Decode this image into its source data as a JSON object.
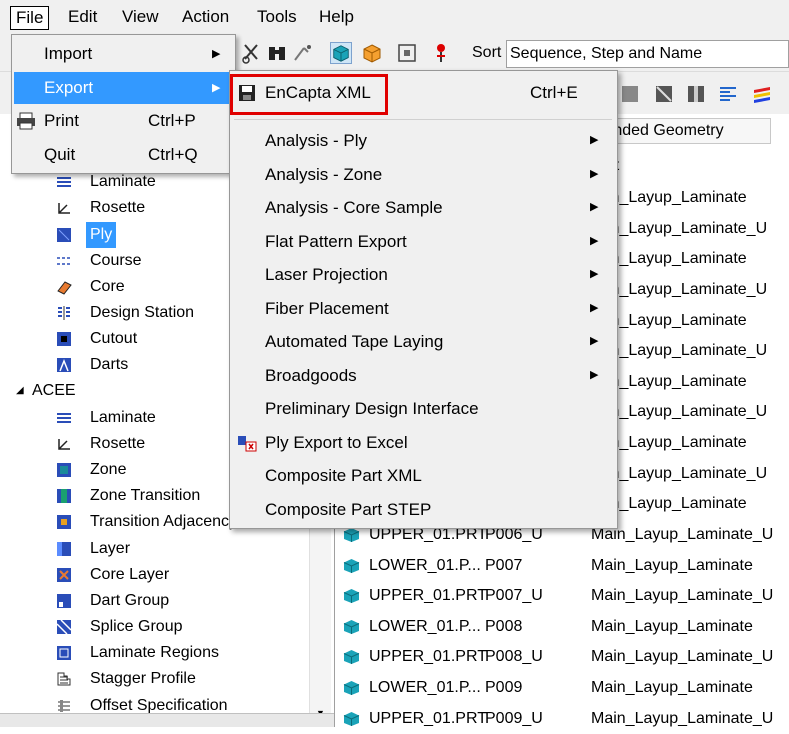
{
  "menubar": [
    "File",
    "Edit",
    "View",
    "Action",
    "Tools",
    "Help"
  ],
  "sort": {
    "label": "Sort",
    "value": "Sequence, Step and Name"
  },
  "columns": {
    "extended_geometry": "tended Geometry",
    "parent": "ent"
  },
  "file_menu": {
    "import": "Import",
    "export": "Export",
    "print": "Print",
    "print_shortcut": "Ctrl+P",
    "quit": "Quit",
    "quit_shortcut": "Ctrl+Q"
  },
  "export_menu": {
    "encapta": "EnCapta XML",
    "encapta_shortcut": "Ctrl+E",
    "items": [
      "Analysis - Ply",
      "Analysis - Zone",
      "Analysis - Core Sample",
      "Flat Pattern Export",
      "Laser Projection",
      "Fiber Placement",
      "Automated Tape Laying",
      "Broadgoods",
      "Preliminary Design Interface",
      "Ply Export to Excel",
      "Composite Part XML",
      "Composite Part STEP"
    ]
  },
  "tree": {
    "group1": [
      "Laminate",
      "Rosette",
      "Ply",
      "Course",
      "Core",
      "Design Station",
      "Cutout",
      "Darts"
    ],
    "acee": "ACEE",
    "group2": [
      "Laminate",
      "Rosette",
      "Zone",
      "Zone Transition",
      "Transition Adjacency",
      "Layer",
      "Core Layer",
      "Dart Group",
      "Splice Group",
      "Laminate Regions",
      "Stagger Profile",
      "Offset Specification"
    ]
  },
  "rows_partial": [
    "in_Layup_Laminate",
    "in_Layup_Laminate_U",
    "in_Layup_Laminate",
    "in_Layup_Laminate_U",
    "in_Layup_Laminate",
    "in_Layup_Laminate_U",
    "in_Layup_Laminate",
    "in_Layup_Laminate_U",
    "in_Layup_Laminate",
    "in_Layup_Laminate_U",
    "in_Layup_Laminate"
  ],
  "rows": [
    {
      "part": "UPPER_01.PRT",
      "ply": "P006_U",
      "laminate": "Main_Layup_Laminate_U"
    },
    {
      "part": "LOWER_01.P...",
      "ply": "P007",
      "laminate": "Main_Layup_Laminate"
    },
    {
      "part": "UPPER_01.PRT",
      "ply": "P007_U",
      "laminate": "Main_Layup_Laminate_U"
    },
    {
      "part": "LOWER_01.P...",
      "ply": "P008",
      "laminate": "Main_Layup_Laminate"
    },
    {
      "part": "UPPER_01.PRT",
      "ply": "P008_U",
      "laminate": "Main_Layup_Laminate_U"
    },
    {
      "part": "LOWER_01.P...",
      "ply": "P009",
      "laminate": "Main_Layup_Laminate"
    },
    {
      "part": "UPPER_01.PRT",
      "ply": "P009_U",
      "laminate": "Main_Layup_Laminate_U"
    }
  ],
  "colors": {
    "selection": "#3399ff",
    "highlight_box": "#e00000",
    "cube": "#1aa3b8"
  }
}
